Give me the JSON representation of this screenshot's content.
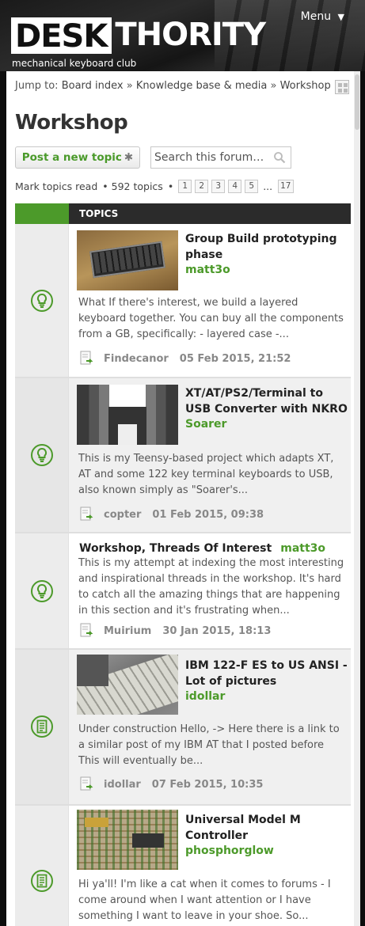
{
  "header": {
    "logo_box": "DESK",
    "logo_rest": "THORITY",
    "tagline": "mechanical keyboard club",
    "menu_label": "Menu",
    "menu_arrow": "▼"
  },
  "breadcrumb": {
    "jump_label": "Jump to:",
    "items": [
      "Board index",
      "Knowledge base & media",
      "Workshop"
    ],
    "separator": "»"
  },
  "page_title": "Workshop",
  "actions": {
    "post_label": "Post a new topic",
    "post_icon": "✱",
    "search_placeholder": "Search this forum…"
  },
  "pagination": {
    "mark_read": "Mark topics read",
    "bullet": "•",
    "topic_count": "592 topics",
    "pages": [
      "1",
      "2",
      "3",
      "4",
      "5"
    ],
    "ellipsis": "...",
    "last_page": "17"
  },
  "topics_header": "TOPICS",
  "colors": {
    "accent": "#4c9a2a",
    "header_bg": "#2b2b2b"
  },
  "topics": [
    {
      "title": "Group Build prototyping phase",
      "author": "matt3o",
      "excerpt": "What If there's interest, we build a layered keyboard together. You can buy all the components from a GB, specifically: - layered case -...",
      "last_poster": "Findecanor",
      "last_date": "05 Feb 2015, 21:52",
      "icon": "lightbulb-icon"
    },
    {
      "title": "XT/AT/PS2/Terminal to USB Converter with NKRO",
      "author": "Soarer",
      "excerpt": "This is my Teensy-based project which adapts XT, AT and some 122 key terminal keyboards to USB, also known simply as \"Soarer's...",
      "last_poster": "copter",
      "last_date": "01 Feb 2015, 09:38",
      "icon": "lightbulb-icon"
    },
    {
      "title": "Workshop, Threads Of Interest",
      "author": "matt3o",
      "excerpt": "This is my attempt at indexing the most interesting and inspirational threads in the workshop. It's hard to catch all the amazing things that are happening in this section and it's frustrating when...",
      "last_poster": "Muirium",
      "last_date": "30 Jan 2015, 18:13",
      "icon": "lightbulb-icon"
    },
    {
      "title": "IBM 122-F ES to US ANSI - Lot of pictures",
      "author": "idollar",
      "excerpt": "Under construction Hello, -> Here there is a link to a similar post of my IBM AT that I posted before This will eventually be...",
      "last_poster": "idollar",
      "last_date": "07 Feb 2015, 10:35",
      "icon": "document-icon"
    },
    {
      "title": "Universal Model M Controller",
      "author": "phosphorglow",
      "excerpt": "Hi ya'll! I'm like a cat when it comes to forums - I come around when I want attention or I have something I want to leave in your shoe. So...",
      "last_poster": "",
      "last_date": "",
      "icon": "document-icon"
    }
  ]
}
